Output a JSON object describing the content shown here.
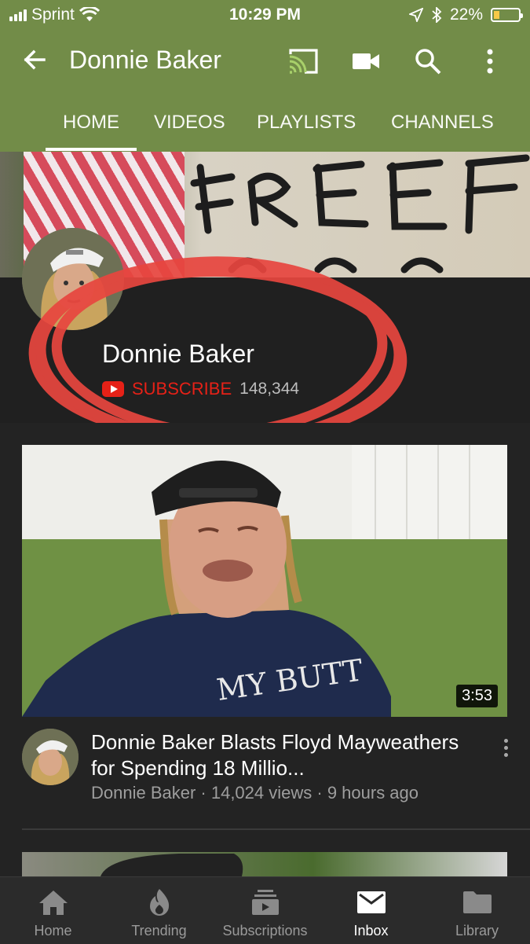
{
  "status_bar": {
    "carrier": "Sprint",
    "time": "10:29 PM",
    "battery_percent": "22%",
    "battery_level": 0.22
  },
  "app_bar": {
    "title": "Donnie Baker",
    "icons": [
      "back-arrow-icon",
      "cast-icon",
      "video-camera-icon",
      "search-icon",
      "more-vert-icon"
    ]
  },
  "tabs": [
    {
      "label": "HOME",
      "active": true
    },
    {
      "label": "VIDEOS",
      "active": false
    },
    {
      "label": "PLAYLISTS",
      "active": false
    },
    {
      "label": "CHANNELS",
      "active": false
    }
  ],
  "channel": {
    "name": "Donnie Baker",
    "subscribe_label": "SUBSCRIBE",
    "subscriber_count": "148,344"
  },
  "videos": [
    {
      "title": "Donnie Baker Blasts Floyd Mayweathers for Spending 18 Millio...",
      "meta": "Donnie Baker · 14,024 views · 9 hours ago",
      "duration": "3:53",
      "shirt_text": "MY BUTT"
    }
  ],
  "bottom_nav": [
    {
      "label": "Home",
      "icon": "home-icon",
      "active": false
    },
    {
      "label": "Trending",
      "icon": "flame-icon",
      "active": false
    },
    {
      "label": "Subscriptions",
      "icon": "subscriptions-icon",
      "active": false
    },
    {
      "label": "Inbox",
      "icon": "mail-icon",
      "active": true
    },
    {
      "label": "Library",
      "icon": "folder-icon",
      "active": false
    }
  ],
  "colors": {
    "app_bar": "#728c48",
    "background": "#232323",
    "subscribe_red": "#e62117"
  }
}
